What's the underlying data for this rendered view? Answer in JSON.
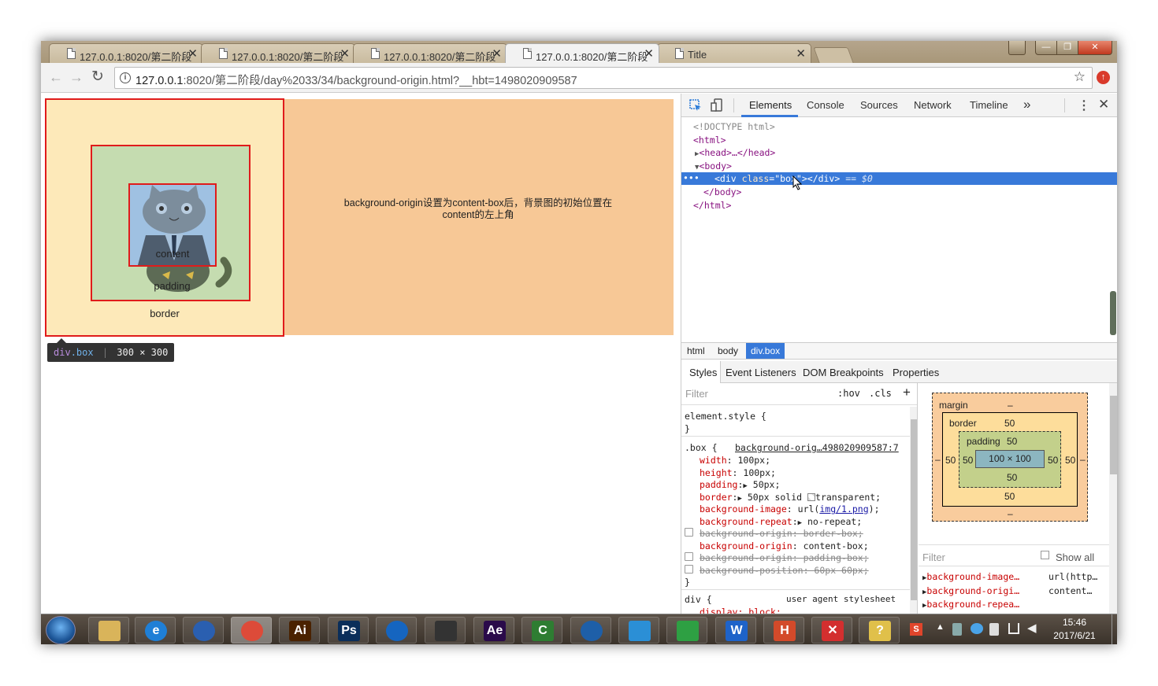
{
  "browser": {
    "tabs": [
      {
        "title": "127.0.0.1:8020/第二阶段",
        "close": "✕"
      },
      {
        "title": "127.0.0.1:8020/第二阶段",
        "close": "✕"
      },
      {
        "title": "127.0.0.1:8020/第二阶段",
        "close": "✕"
      },
      {
        "title": "127.0.0.1:8020/第二阶段",
        "close": "✕",
        "active": true
      },
      {
        "title": "Title",
        "close": "✕"
      }
    ],
    "url_host": "127.0.0.1",
    "url_rest": ":8020/第二阶段/day%2033/34/background-origin.html?__hbt=1498020909587",
    "window_controls": {
      "minimize": "—",
      "restore": "❐",
      "close": "✕"
    }
  },
  "page": {
    "content_label": "content",
    "padding_label": "padding",
    "border_label": "border",
    "description": "background-origin设置为content-box后，背景图的初始位置在content的左上角",
    "tooltip_selector_tag": "div",
    "tooltip_selector_class": ".box",
    "tooltip_size": "300 × 300"
  },
  "devtools": {
    "tabs": [
      "Elements",
      "Console",
      "Sources",
      "Network",
      "Timeline"
    ],
    "active_tab": "Elements",
    "more": "»",
    "dom": {
      "doctype": "<!DOCTYPE html>",
      "html_open": "<html>",
      "head": "<head>…</head>",
      "body_open": "<body>",
      "div_tag_open": "<div ",
      "div_attr": "class",
      "div_val": "\"box\"",
      "div_tag_close": "></div>",
      "div_marker": "== $0",
      "body_close": "</body>",
      "html_close": "</html>",
      "ellipsis": "•••"
    },
    "breadcrumbs": [
      "html",
      "body",
      "div.box"
    ],
    "subtabs": [
      "Styles",
      "Event Listeners",
      "DOM Breakpoints",
      "Properties"
    ],
    "filter_placeholder": "Filter",
    "hov": ":hov",
    "cls": ".cls",
    "plus": "+",
    "element_style": "element.style {",
    "close_brace": "}",
    "box_rule": ".box {",
    "box_source": "background-orig…498020909587:7",
    "decls": [
      {
        "name": "width",
        "value": "100px;"
      },
      {
        "name": "height",
        "value": "100px;"
      },
      {
        "name": "padding",
        "value": "50px;"
      },
      {
        "name": "border",
        "value": "50px solid ",
        "swatch_value": "transparent;"
      },
      {
        "name": "background-image",
        "value_pre": "url(",
        "link": "img/1.png",
        "value_post": ");"
      },
      {
        "name": "background-repeat",
        "value": "no-repeat;"
      },
      {
        "name": "background-origin",
        "value": "border-box;",
        "struck": true
      },
      {
        "name": "background-origin",
        "value": "content-box;"
      },
      {
        "name": "background-origin",
        "value": "padding-box;",
        "struck": true
      },
      {
        "name": "background-position",
        "value": "60px 60px;",
        "struck": true
      }
    ],
    "div_rule": "div {",
    "ua_label": "user agent stylesheet",
    "ua_decl": "display: block;",
    "metrics": {
      "margin_label": "margin",
      "margin_top": "–",
      "margin_bottom": "–",
      "margin_left": "–",
      "margin_right": "–",
      "border_label": "border",
      "border_top": "50",
      "border_bottom": "50",
      "border_left": "50",
      "border_right": "50",
      "padding_label": "padding",
      "padding_top": "50",
      "padding_bottom": "50",
      "padding_left": "50",
      "padding_right": "50",
      "content_size": "100 × 100"
    },
    "computed_filter": "Filter",
    "show_all": "Show all",
    "computed": [
      {
        "name": "background-image…",
        "value": "url(http…"
      },
      {
        "name": "background-origi…",
        "value": "content…"
      },
      {
        "name": "background-repea…",
        "value": ""
      }
    ]
  },
  "taskbar": {
    "time": "15:46",
    "date": "2017/6/21",
    "apps": [
      {
        "name": "explorer",
        "label": "",
        "color": "#d9b45a"
      },
      {
        "name": "ie",
        "label": "e",
        "color": "#1f7fd6"
      },
      {
        "name": "firefox",
        "label": "",
        "color": "#2a5fb0"
      },
      {
        "name": "chrome",
        "label": "",
        "color": "#dd4b39"
      },
      {
        "name": "illustrator",
        "label": "Ai",
        "color": "#4a2200"
      },
      {
        "name": "photoshop",
        "label": "Ps",
        "color": "#0a2e5a"
      },
      {
        "name": "app-blue",
        "label": "",
        "color": "#1565c0"
      },
      {
        "name": "app-dark",
        "label": "",
        "color": "#333333"
      },
      {
        "name": "after-effects",
        "label": "Ae",
        "color": "#2a0a4a"
      },
      {
        "name": "camtasia",
        "label": "C",
        "color": "#2e7d32"
      },
      {
        "name": "app-camera",
        "label": "",
        "color": "#1e5fa8"
      },
      {
        "name": "app-cloud",
        "label": "",
        "color": "#2b8fd6"
      },
      {
        "name": "app-green",
        "label": "",
        "color": "#2ea043"
      },
      {
        "name": "wps",
        "label": "W",
        "color": "#1e63c9"
      },
      {
        "name": "hbuilder",
        "label": "H",
        "color": "#d34a2a"
      },
      {
        "name": "xmind",
        "label": "✕",
        "color": "#d32f2f"
      },
      {
        "name": "help",
        "label": "?",
        "color": "#e0c04a"
      }
    ]
  }
}
